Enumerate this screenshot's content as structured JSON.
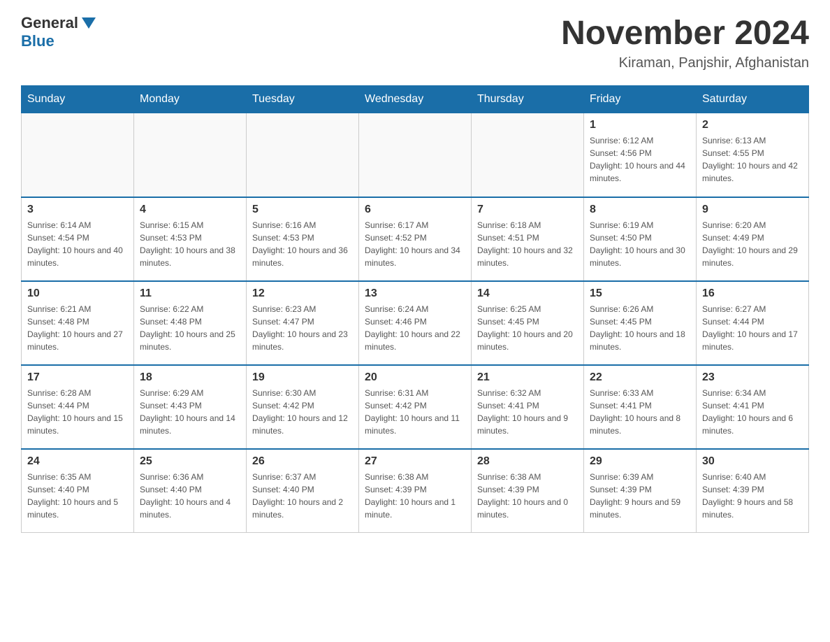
{
  "header": {
    "logo_general": "General",
    "logo_blue": "Blue",
    "month": "November 2024",
    "location": "Kiraman, Panjshir, Afghanistan"
  },
  "days_of_week": [
    "Sunday",
    "Monday",
    "Tuesday",
    "Wednesday",
    "Thursday",
    "Friday",
    "Saturday"
  ],
  "weeks": [
    [
      {
        "day": "",
        "sunrise": "",
        "sunset": "",
        "daylight": ""
      },
      {
        "day": "",
        "sunrise": "",
        "sunset": "",
        "daylight": ""
      },
      {
        "day": "",
        "sunrise": "",
        "sunset": "",
        "daylight": ""
      },
      {
        "day": "",
        "sunrise": "",
        "sunset": "",
        "daylight": ""
      },
      {
        "day": "",
        "sunrise": "",
        "sunset": "",
        "daylight": ""
      },
      {
        "day": "1",
        "sunrise": "Sunrise: 6:12 AM",
        "sunset": "Sunset: 4:56 PM",
        "daylight": "Daylight: 10 hours and 44 minutes."
      },
      {
        "day": "2",
        "sunrise": "Sunrise: 6:13 AM",
        "sunset": "Sunset: 4:55 PM",
        "daylight": "Daylight: 10 hours and 42 minutes."
      }
    ],
    [
      {
        "day": "3",
        "sunrise": "Sunrise: 6:14 AM",
        "sunset": "Sunset: 4:54 PM",
        "daylight": "Daylight: 10 hours and 40 minutes."
      },
      {
        "day": "4",
        "sunrise": "Sunrise: 6:15 AM",
        "sunset": "Sunset: 4:53 PM",
        "daylight": "Daylight: 10 hours and 38 minutes."
      },
      {
        "day": "5",
        "sunrise": "Sunrise: 6:16 AM",
        "sunset": "Sunset: 4:53 PM",
        "daylight": "Daylight: 10 hours and 36 minutes."
      },
      {
        "day": "6",
        "sunrise": "Sunrise: 6:17 AM",
        "sunset": "Sunset: 4:52 PM",
        "daylight": "Daylight: 10 hours and 34 minutes."
      },
      {
        "day": "7",
        "sunrise": "Sunrise: 6:18 AM",
        "sunset": "Sunset: 4:51 PM",
        "daylight": "Daylight: 10 hours and 32 minutes."
      },
      {
        "day": "8",
        "sunrise": "Sunrise: 6:19 AM",
        "sunset": "Sunset: 4:50 PM",
        "daylight": "Daylight: 10 hours and 30 minutes."
      },
      {
        "day": "9",
        "sunrise": "Sunrise: 6:20 AM",
        "sunset": "Sunset: 4:49 PM",
        "daylight": "Daylight: 10 hours and 29 minutes."
      }
    ],
    [
      {
        "day": "10",
        "sunrise": "Sunrise: 6:21 AM",
        "sunset": "Sunset: 4:48 PM",
        "daylight": "Daylight: 10 hours and 27 minutes."
      },
      {
        "day": "11",
        "sunrise": "Sunrise: 6:22 AM",
        "sunset": "Sunset: 4:48 PM",
        "daylight": "Daylight: 10 hours and 25 minutes."
      },
      {
        "day": "12",
        "sunrise": "Sunrise: 6:23 AM",
        "sunset": "Sunset: 4:47 PM",
        "daylight": "Daylight: 10 hours and 23 minutes."
      },
      {
        "day": "13",
        "sunrise": "Sunrise: 6:24 AM",
        "sunset": "Sunset: 4:46 PM",
        "daylight": "Daylight: 10 hours and 22 minutes."
      },
      {
        "day": "14",
        "sunrise": "Sunrise: 6:25 AM",
        "sunset": "Sunset: 4:45 PM",
        "daylight": "Daylight: 10 hours and 20 minutes."
      },
      {
        "day": "15",
        "sunrise": "Sunrise: 6:26 AM",
        "sunset": "Sunset: 4:45 PM",
        "daylight": "Daylight: 10 hours and 18 minutes."
      },
      {
        "day": "16",
        "sunrise": "Sunrise: 6:27 AM",
        "sunset": "Sunset: 4:44 PM",
        "daylight": "Daylight: 10 hours and 17 minutes."
      }
    ],
    [
      {
        "day": "17",
        "sunrise": "Sunrise: 6:28 AM",
        "sunset": "Sunset: 4:44 PM",
        "daylight": "Daylight: 10 hours and 15 minutes."
      },
      {
        "day": "18",
        "sunrise": "Sunrise: 6:29 AM",
        "sunset": "Sunset: 4:43 PM",
        "daylight": "Daylight: 10 hours and 14 minutes."
      },
      {
        "day": "19",
        "sunrise": "Sunrise: 6:30 AM",
        "sunset": "Sunset: 4:42 PM",
        "daylight": "Daylight: 10 hours and 12 minutes."
      },
      {
        "day": "20",
        "sunrise": "Sunrise: 6:31 AM",
        "sunset": "Sunset: 4:42 PM",
        "daylight": "Daylight: 10 hours and 11 minutes."
      },
      {
        "day": "21",
        "sunrise": "Sunrise: 6:32 AM",
        "sunset": "Sunset: 4:41 PM",
        "daylight": "Daylight: 10 hours and 9 minutes."
      },
      {
        "day": "22",
        "sunrise": "Sunrise: 6:33 AM",
        "sunset": "Sunset: 4:41 PM",
        "daylight": "Daylight: 10 hours and 8 minutes."
      },
      {
        "day": "23",
        "sunrise": "Sunrise: 6:34 AM",
        "sunset": "Sunset: 4:41 PM",
        "daylight": "Daylight: 10 hours and 6 minutes."
      }
    ],
    [
      {
        "day": "24",
        "sunrise": "Sunrise: 6:35 AM",
        "sunset": "Sunset: 4:40 PM",
        "daylight": "Daylight: 10 hours and 5 minutes."
      },
      {
        "day": "25",
        "sunrise": "Sunrise: 6:36 AM",
        "sunset": "Sunset: 4:40 PM",
        "daylight": "Daylight: 10 hours and 4 minutes."
      },
      {
        "day": "26",
        "sunrise": "Sunrise: 6:37 AM",
        "sunset": "Sunset: 4:40 PM",
        "daylight": "Daylight: 10 hours and 2 minutes."
      },
      {
        "day": "27",
        "sunrise": "Sunrise: 6:38 AM",
        "sunset": "Sunset: 4:39 PM",
        "daylight": "Daylight: 10 hours and 1 minute."
      },
      {
        "day": "28",
        "sunrise": "Sunrise: 6:38 AM",
        "sunset": "Sunset: 4:39 PM",
        "daylight": "Daylight: 10 hours and 0 minutes."
      },
      {
        "day": "29",
        "sunrise": "Sunrise: 6:39 AM",
        "sunset": "Sunset: 4:39 PM",
        "daylight": "Daylight: 9 hours and 59 minutes."
      },
      {
        "day": "30",
        "sunrise": "Sunrise: 6:40 AM",
        "sunset": "Sunset: 4:39 PM",
        "daylight": "Daylight: 9 hours and 58 minutes."
      }
    ]
  ]
}
